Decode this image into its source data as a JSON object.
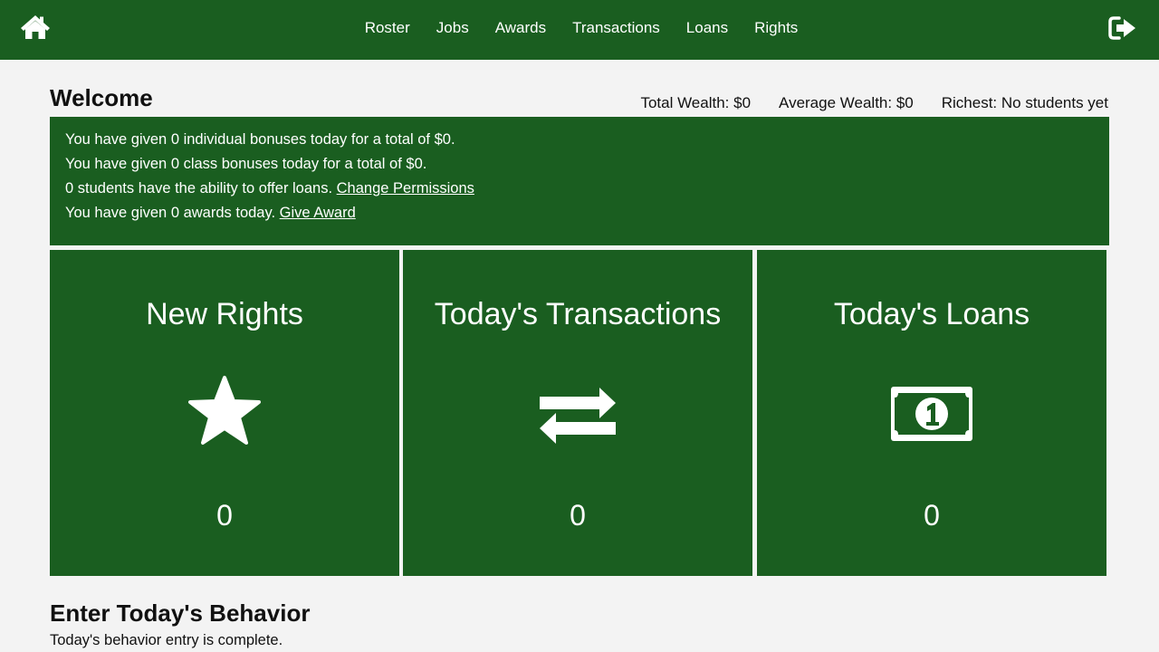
{
  "nav": {
    "home_icon": "home-icon",
    "logout_icon": "sign-out-icon",
    "items": [
      "Roster",
      "Jobs",
      "Awards",
      "Transactions",
      "Loans",
      "Rights"
    ]
  },
  "welcome": {
    "title": "Welcome",
    "total_wealth": "Total Wealth: $0",
    "average_wealth": "Average Wealth: $0",
    "richest": "Richest: No students yet"
  },
  "info": {
    "line1": "You have given 0 individual bonuses today for a total of $0.",
    "line2": "You have given 0 class bonuses today for a total of $0.",
    "line3_text": "0 students have the ability to offer loans. ",
    "line3_link": "Change Permissions",
    "line4_text": "You have given 0 awards today. ",
    "line4_link": "Give Award"
  },
  "cards": [
    {
      "title": "New Rights",
      "icon": "star-icon",
      "count": "0"
    },
    {
      "title": "Today's Transactions",
      "icon": "exchange-arrows-icon",
      "count": "0"
    },
    {
      "title": "Today's Loans",
      "icon": "money-bill-icon",
      "count": "0"
    }
  ],
  "behavior": {
    "title": "Enter Today's Behavior",
    "status": "Today's behavior entry is complete."
  },
  "colors": {
    "brand_green": "#1a5e20",
    "background": "#f3f3f3"
  }
}
